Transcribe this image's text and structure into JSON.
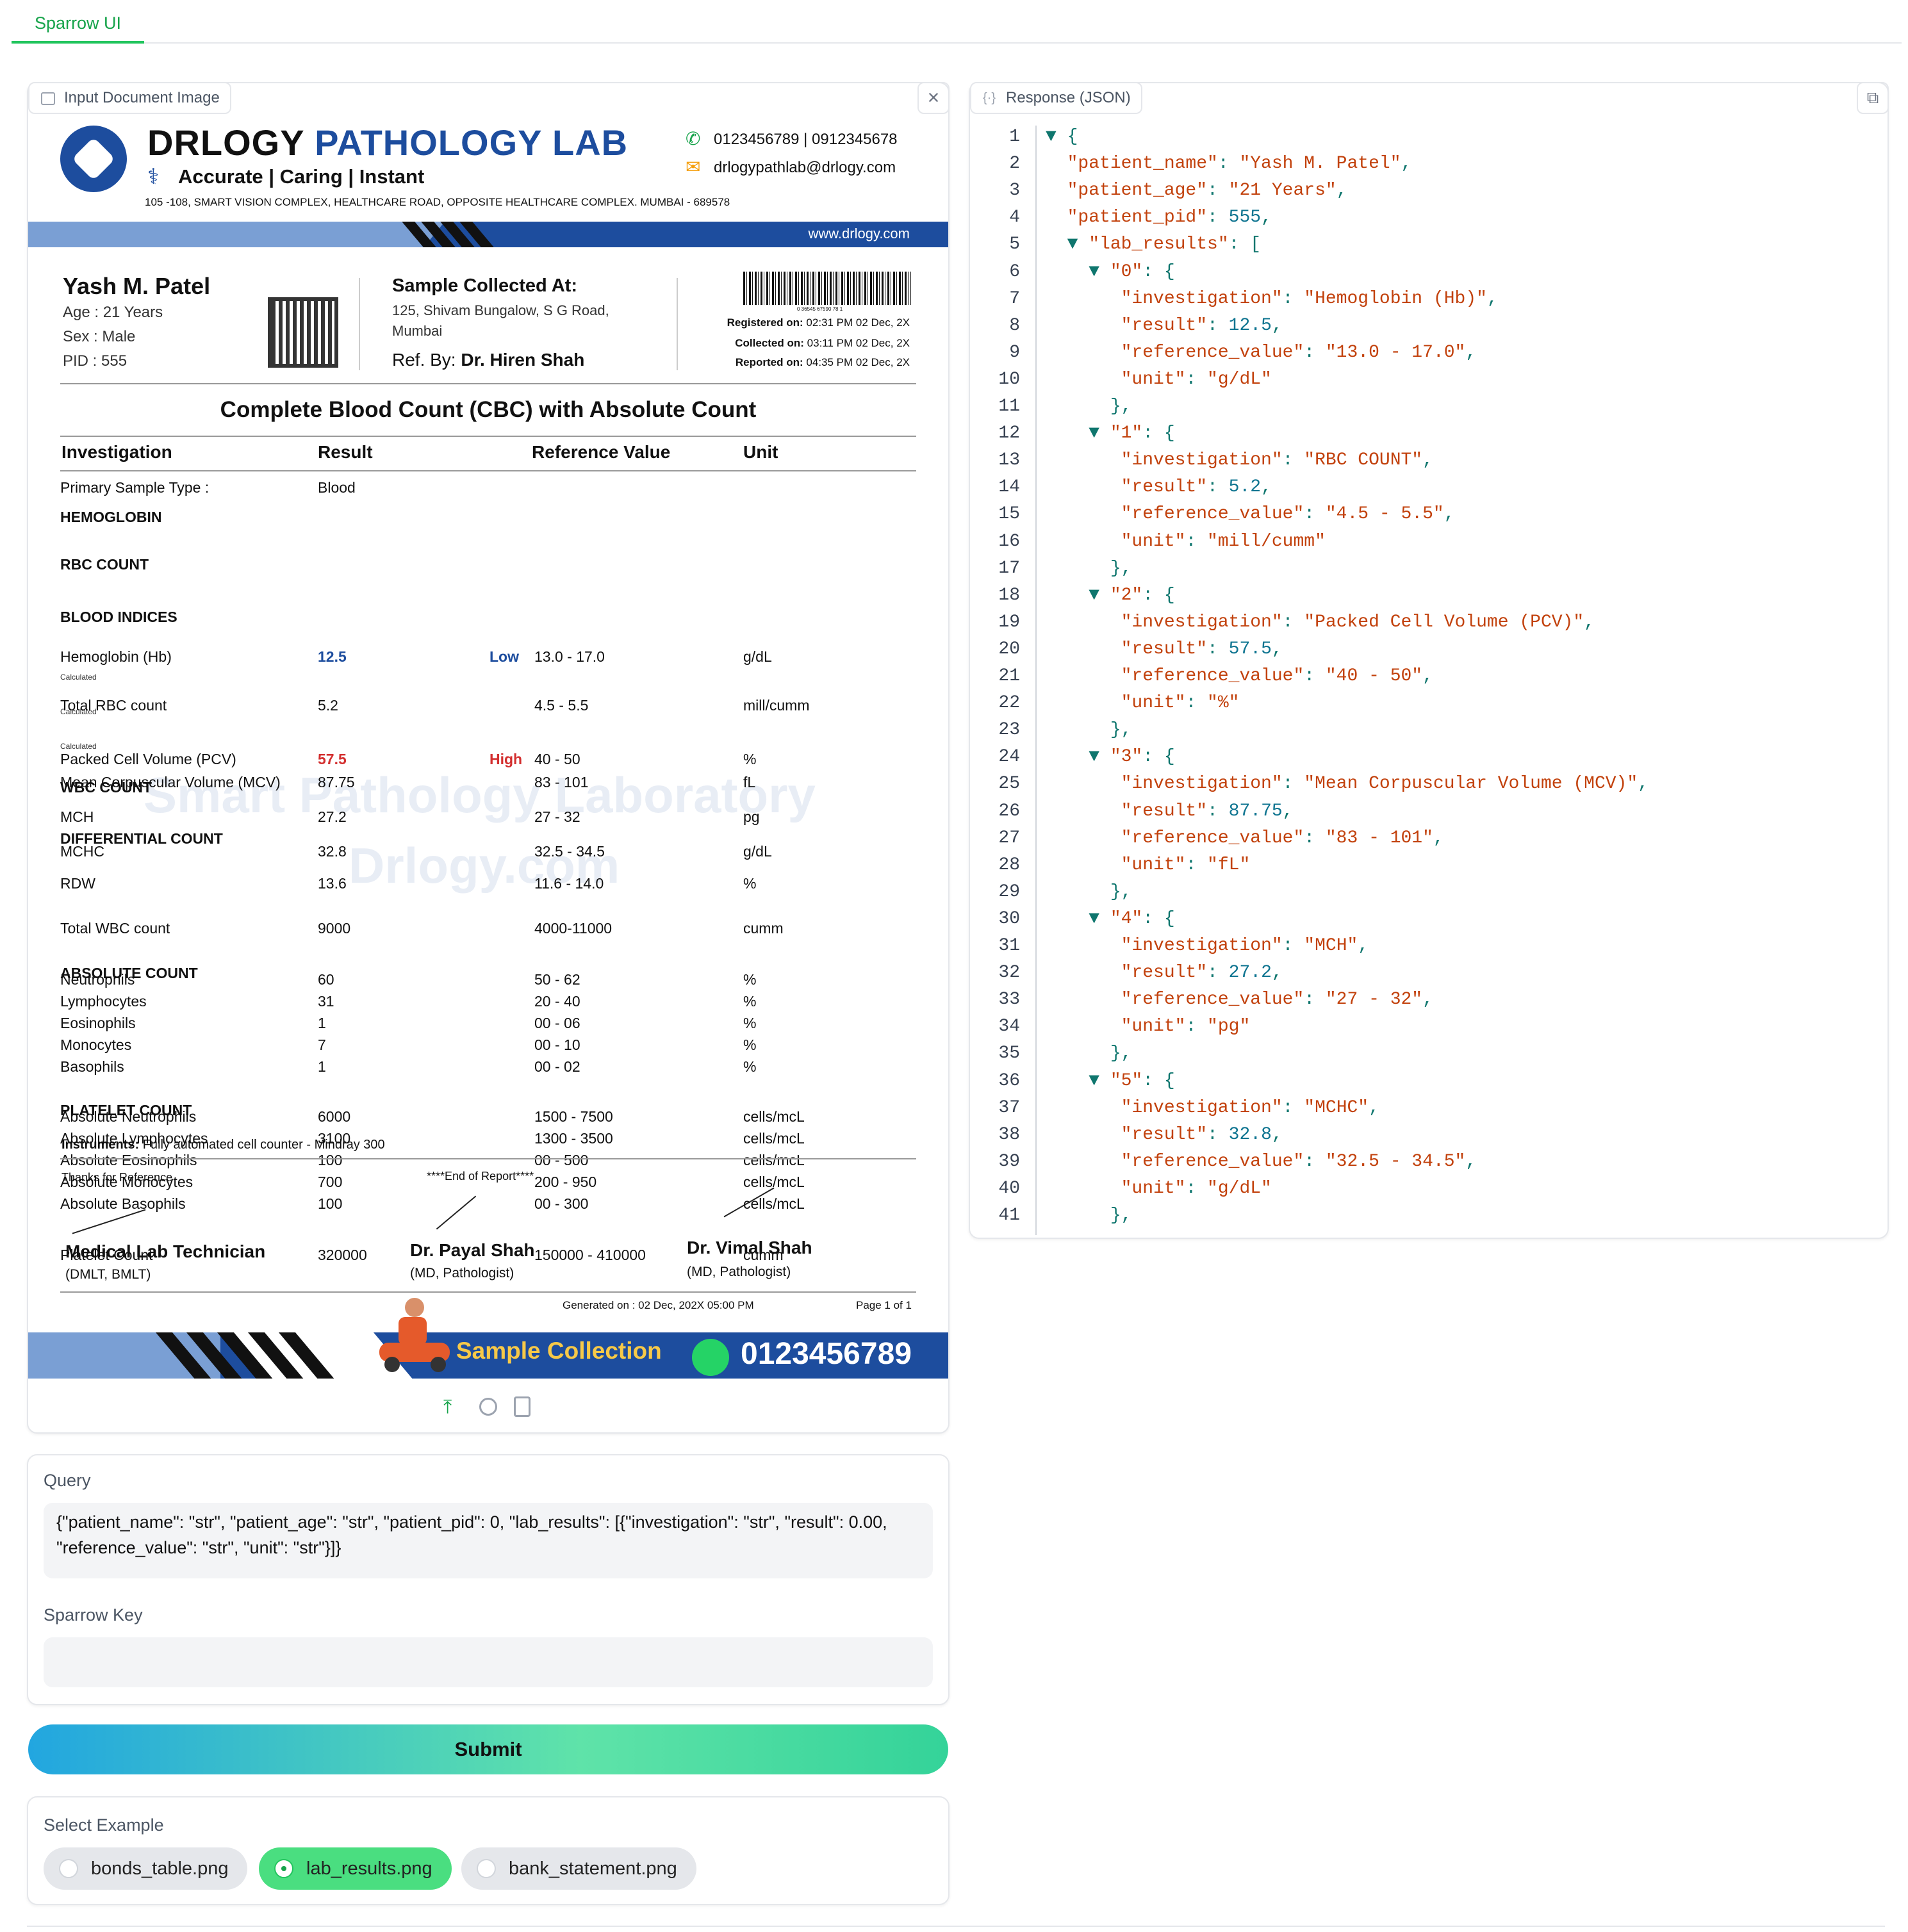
{
  "app": {
    "tab": "Sparrow UI"
  },
  "left": {
    "badge": "Input Document Image",
    "doc": {
      "lab_name_1": "DRLOGY",
      "lab_name_2": "PATHOLOGY LAB",
      "tagline_1": "Accurate",
      "tagline_2": "|  Caring",
      "tagline_3": "|  Instant",
      "address": "105 -108, SMART VISION COMPLEX, HEALTHCARE ROAD, OPPOSITE HEALTHCARE COMPLEX. MUMBAI - 689578",
      "phone": "0123456789  | 0912345678",
      "email": "drlogypathlab@drlogy.com",
      "website": "www.drlogy.com",
      "patient_name": "Yash M. Patel",
      "age": "Age : 21 Years",
      "sex": "Sex : Male",
      "pid": "PID : 555",
      "sample_collected_label": "Sample Collected At:",
      "sample_addr_1": "125, Shivam Bungalow, S G Road,",
      "sample_addr_2": "Mumbai",
      "ref_by_label": "Ref. By:",
      "ref_by": "Dr. Hiren Shah",
      "barcode_num": "0 36545 67590 78 1",
      "registered_label": "Registered on:",
      "registered": "02:31 PM 02 Dec, 2X",
      "collected_label": "Collected on:",
      "collected": "03:11 PM 02 Dec, 2X",
      "reported_label": "Reported on:",
      "reported": "04:35 PM 02 Dec, 2X",
      "title": "Complete Blood Count (CBC) with Absolute Count",
      "headers": [
        "Investigation",
        "Result",
        "Reference Value",
        "Unit"
      ],
      "primary_sample_label": "Primary Sample Type :",
      "primary_sample": "Blood",
      "sections": {
        "hemoglobin": "HEMOGLOBIN",
        "rbc": "RBC COUNT",
        "indices": "BLOOD INDICES",
        "wbc": "WBC COUNT",
        "diff": "DIFFERENTIAL COUNT",
        "abs": "ABSOLUTE COUNT",
        "plt": "PLATELET COUNT"
      },
      "calculated": "Calculated",
      "rows": [
        {
          "name": "Hemoglobin (Hb)",
          "result": "12.5",
          "flag": "Low",
          "ref": "13.0 - 17.0",
          "unit": "g/dL"
        },
        {
          "name": "Total RBC count",
          "result": "5.2",
          "flag": "",
          "ref": "4.5 - 5.5",
          "unit": "mill/cumm"
        },
        {
          "name": "Packed Cell Volume (PCV)",
          "result": "57.5",
          "flag": "High",
          "ref": "40 - 50",
          "unit": "%"
        },
        {
          "name": "Mean Corpuscular Volume (MCV)",
          "result": "87.75",
          "flag": "",
          "ref": "83 - 101",
          "unit": "fL"
        },
        {
          "name": "MCH",
          "result": "27.2",
          "flag": "",
          "ref": "27 - 32",
          "unit": "pg"
        },
        {
          "name": "MCHC",
          "result": "32.8",
          "flag": "",
          "ref": "32.5 - 34.5",
          "unit": "g/dL"
        },
        {
          "name": "RDW",
          "result": "13.6",
          "flag": "",
          "ref": "11.6 - 14.0",
          "unit": "%"
        },
        {
          "name": "Total WBC count",
          "result": "9000",
          "flag": "",
          "ref": "4000-11000",
          "unit": "cumm"
        },
        {
          "name": "Neutrophils",
          "result": "60",
          "flag": "",
          "ref": "50 - 62",
          "unit": "%"
        },
        {
          "name": "Lymphocytes",
          "result": "31",
          "flag": "",
          "ref": "20 - 40",
          "unit": "%"
        },
        {
          "name": "Eosinophils",
          "result": "1",
          "flag": "",
          "ref": "00 - 06",
          "unit": "%"
        },
        {
          "name": "Monocytes",
          "result": "7",
          "flag": "",
          "ref": "00 - 10",
          "unit": "%"
        },
        {
          "name": "Basophils",
          "result": "1",
          "flag": "",
          "ref": "00 - 02",
          "unit": "%"
        },
        {
          "name": "Absolute Neutrophils",
          "result": "6000",
          "flag": "",
          "ref": "1500 - 7500",
          "unit": "cells/mcL"
        },
        {
          "name": "Absolute Lymphocytes",
          "result": "3100",
          "flag": "",
          "ref": "1300 - 3500",
          "unit": "cells/mcL"
        },
        {
          "name": "Absolute Eosinophils",
          "result": "100",
          "flag": "",
          "ref": "00 - 500",
          "unit": "cells/mcL"
        },
        {
          "name": "Absolute Monocytes",
          "result": "700",
          "flag": "",
          "ref": "200 - 950",
          "unit": "cells/mcL"
        },
        {
          "name": "Absolute Basophils",
          "result": "100",
          "flag": "",
          "ref": "00 - 300",
          "unit": "cells/mcL"
        },
        {
          "name": "Platelet Count",
          "result": "320000",
          "flag": "",
          "ref": "150000 - 410000",
          "unit": "cumm"
        }
      ],
      "instruments_label": "Instruments:",
      "instruments": "Fully automated cell counter - Mindray 300",
      "thanks": "Thanks for Reference",
      "end": "****End of Report****",
      "sig1_name": "Medical Lab Technician",
      "sig1_role": "(DMLT, BMLT)",
      "sig2_name": "Dr. Payal Shah",
      "sig2_role": "(MD, Pathologist)",
      "sig3_name": "Dr. Vimal Shah",
      "sig3_role": "(MD, Pathologist)",
      "generated": "Generated on :  02 Dec, 202X 05:00 PM",
      "page": "Page 1 of 1",
      "sample_collection": "Sample Collection",
      "footer_phone": "0123456789",
      "watermark_1": "Smart Pathology Laboratory",
      "watermark_2": "Drlogy.com"
    },
    "query_label": "Query",
    "query_value": "{\"patient_name\": \"str\", \"patient_age\": \"str\", \"patient_pid\": 0, \"lab_results\": [{\"investigation\": \"str\", \"result\": 0.00, \"reference_value\": \"str\", \"unit\": \"str\"}]}",
    "key_label": "Sparrow Key",
    "key_value": "",
    "submit": "Submit",
    "examples_label": "Select Example",
    "examples": [
      "bonds_table.png",
      "lab_results.png",
      "bank_statement.png"
    ],
    "selected_example": "lab_results.png"
  },
  "right": {
    "badge": "Response (JSON)",
    "lines": [
      {
        "n": "1",
        "t": [
          [
            "pun",
            "▼ {"
          ]
        ]
      },
      {
        "n": "2",
        "t": [
          [
            "key",
            "  \"patient_name\""
          ],
          [
            "pun",
            ": "
          ],
          [
            "str",
            "\"Yash M. Patel\""
          ],
          [
            "pun",
            ","
          ]
        ]
      },
      {
        "n": "3",
        "t": [
          [
            "key",
            "  \"patient_age\""
          ],
          [
            "pun",
            ": "
          ],
          [
            "str",
            "\"21 Years\""
          ],
          [
            "pun",
            ","
          ]
        ]
      },
      {
        "n": "4",
        "t": [
          [
            "key",
            "  \"patient_pid\""
          ],
          [
            "pun",
            ": "
          ],
          [
            "num",
            "555"
          ],
          [
            "pun",
            ","
          ]
        ]
      },
      {
        "n": "5",
        "t": [
          [
            "pun",
            "  ▼ "
          ],
          [
            "key",
            "\"lab_results\""
          ],
          [
            "pun",
            ": ["
          ]
        ]
      },
      {
        "n": "6",
        "t": [
          [
            "pun",
            "    ▼ "
          ],
          [
            "key",
            "\"0\""
          ],
          [
            "pun",
            ": {"
          ]
        ]
      },
      {
        "n": "7",
        "t": [
          [
            "key",
            "       \"investigation\""
          ],
          [
            "pun",
            ": "
          ],
          [
            "str",
            "\"Hemoglobin (Hb)\""
          ],
          [
            "pun",
            ","
          ]
        ]
      },
      {
        "n": "8",
        "t": [
          [
            "key",
            "       \"result\""
          ],
          [
            "pun",
            ": "
          ],
          [
            "num",
            "12.5"
          ],
          [
            "pun",
            ","
          ]
        ]
      },
      {
        "n": "9",
        "t": [
          [
            "key",
            "       \"reference_value\""
          ],
          [
            "pun",
            ": "
          ],
          [
            "str",
            "\"13.0 - 17.0\""
          ],
          [
            "pun",
            ","
          ]
        ]
      },
      {
        "n": "10",
        "t": [
          [
            "key",
            "       \"unit\""
          ],
          [
            "pun",
            ": "
          ],
          [
            "str",
            "\"g/dL\""
          ]
        ]
      },
      {
        "n": "11",
        "t": [
          [
            "pun",
            "      },"
          ]
        ]
      },
      {
        "n": "12",
        "t": [
          [
            "pun",
            "    ▼ "
          ],
          [
            "key",
            "\"1\""
          ],
          [
            "pun",
            ": {"
          ]
        ]
      },
      {
        "n": "13",
        "t": [
          [
            "key",
            "       \"investigation\""
          ],
          [
            "pun",
            ": "
          ],
          [
            "str",
            "\"RBC COUNT\""
          ],
          [
            "pun",
            ","
          ]
        ]
      },
      {
        "n": "14",
        "t": [
          [
            "key",
            "       \"result\""
          ],
          [
            "pun",
            ": "
          ],
          [
            "num",
            "5.2"
          ],
          [
            "pun",
            ","
          ]
        ]
      },
      {
        "n": "15",
        "t": [
          [
            "key",
            "       \"reference_value\""
          ],
          [
            "pun",
            ": "
          ],
          [
            "str",
            "\"4.5 - 5.5\""
          ],
          [
            "pun",
            ","
          ]
        ]
      },
      {
        "n": "16",
        "t": [
          [
            "key",
            "       \"unit\""
          ],
          [
            "pun",
            ": "
          ],
          [
            "str",
            "\"mill/cumm\""
          ]
        ]
      },
      {
        "n": "17",
        "t": [
          [
            "pun",
            "      },"
          ]
        ]
      },
      {
        "n": "18",
        "t": [
          [
            "pun",
            "    ▼ "
          ],
          [
            "key",
            "\"2\""
          ],
          [
            "pun",
            ": {"
          ]
        ]
      },
      {
        "n": "19",
        "t": [
          [
            "key",
            "       \"investigation\""
          ],
          [
            "pun",
            ": "
          ],
          [
            "str",
            "\"Packed Cell Volume (PCV)\""
          ],
          [
            "pun",
            ","
          ]
        ]
      },
      {
        "n": "20",
        "t": [
          [
            "key",
            "       \"result\""
          ],
          [
            "pun",
            ": "
          ],
          [
            "num",
            "57.5"
          ],
          [
            "pun",
            ","
          ]
        ]
      },
      {
        "n": "21",
        "t": [
          [
            "key",
            "       \"reference_value\""
          ],
          [
            "pun",
            ": "
          ],
          [
            "str",
            "\"40 - 50\""
          ],
          [
            "pun",
            ","
          ]
        ]
      },
      {
        "n": "22",
        "t": [
          [
            "key",
            "       \"unit\""
          ],
          [
            "pun",
            ": "
          ],
          [
            "str",
            "\"%\""
          ]
        ]
      },
      {
        "n": "23",
        "t": [
          [
            "pun",
            "      },"
          ]
        ]
      },
      {
        "n": "24",
        "t": [
          [
            "pun",
            "    ▼ "
          ],
          [
            "key",
            "\"3\""
          ],
          [
            "pun",
            ": {"
          ]
        ]
      },
      {
        "n": "25",
        "t": [
          [
            "key",
            "       \"investigation\""
          ],
          [
            "pun",
            ": "
          ],
          [
            "str",
            "\"Mean Corpuscular Volume (MCV)\""
          ],
          [
            "pun",
            ","
          ]
        ]
      },
      {
        "n": "26",
        "t": [
          [
            "key",
            "       \"result\""
          ],
          [
            "pun",
            ": "
          ],
          [
            "num",
            "87.75"
          ],
          [
            "pun",
            ","
          ]
        ]
      },
      {
        "n": "27",
        "t": [
          [
            "key",
            "       \"reference_value\""
          ],
          [
            "pun",
            ": "
          ],
          [
            "str",
            "\"83 - 101\""
          ],
          [
            "pun",
            ","
          ]
        ]
      },
      {
        "n": "28",
        "t": [
          [
            "key",
            "       \"unit\""
          ],
          [
            "pun",
            ": "
          ],
          [
            "str",
            "\"fL\""
          ]
        ]
      },
      {
        "n": "29",
        "t": [
          [
            "pun",
            "      },"
          ]
        ]
      },
      {
        "n": "30",
        "t": [
          [
            "pun",
            "    ▼ "
          ],
          [
            "key",
            "\"4\""
          ],
          [
            "pun",
            ": {"
          ]
        ]
      },
      {
        "n": "31",
        "t": [
          [
            "key",
            "       \"investigation\""
          ],
          [
            "pun",
            ": "
          ],
          [
            "str",
            "\"MCH\""
          ],
          [
            "pun",
            ","
          ]
        ]
      },
      {
        "n": "32",
        "t": [
          [
            "key",
            "       \"result\""
          ],
          [
            "pun",
            ": "
          ],
          [
            "num",
            "27.2"
          ],
          [
            "pun",
            ","
          ]
        ]
      },
      {
        "n": "33",
        "t": [
          [
            "key",
            "       \"reference_value\""
          ],
          [
            "pun",
            ": "
          ],
          [
            "str",
            "\"27 - 32\""
          ],
          [
            "pun",
            ","
          ]
        ]
      },
      {
        "n": "34",
        "t": [
          [
            "key",
            "       \"unit\""
          ],
          [
            "pun",
            ": "
          ],
          [
            "str",
            "\"pg\""
          ]
        ]
      },
      {
        "n": "35",
        "t": [
          [
            "pun",
            "      },"
          ]
        ]
      },
      {
        "n": "36",
        "t": [
          [
            "pun",
            "    ▼ "
          ],
          [
            "key",
            "\"5\""
          ],
          [
            "pun",
            ": {"
          ]
        ]
      },
      {
        "n": "37",
        "t": [
          [
            "key",
            "       \"investigation\""
          ],
          [
            "pun",
            ": "
          ],
          [
            "str",
            "\"MCHC\""
          ],
          [
            "pun",
            ","
          ]
        ]
      },
      {
        "n": "38",
        "t": [
          [
            "key",
            "       \"result\""
          ],
          [
            "pun",
            ": "
          ],
          [
            "num",
            "32.8"
          ],
          [
            "pun",
            ","
          ]
        ]
      },
      {
        "n": "39",
        "t": [
          [
            "key",
            "       \"reference_value\""
          ],
          [
            "pun",
            ": "
          ],
          [
            "str",
            "\"32.5 - 34.5\""
          ],
          [
            "pun",
            ","
          ]
        ]
      },
      {
        "n": "40",
        "t": [
          [
            "key",
            "       \"unit\""
          ],
          [
            "pun",
            ": "
          ],
          [
            "str",
            "\"g/dL\""
          ]
        ]
      },
      {
        "n": "41",
        "t": [
          [
            "pun",
            "      },"
          ]
        ]
      }
    ]
  },
  "colors": {
    "accent": "#22c55e",
    "doc_blue": "#1d4d9e",
    "low": "#1d4d9e",
    "high": "#d32f2f",
    "json_key": "#c2410c",
    "json_num": "#0e7490"
  }
}
